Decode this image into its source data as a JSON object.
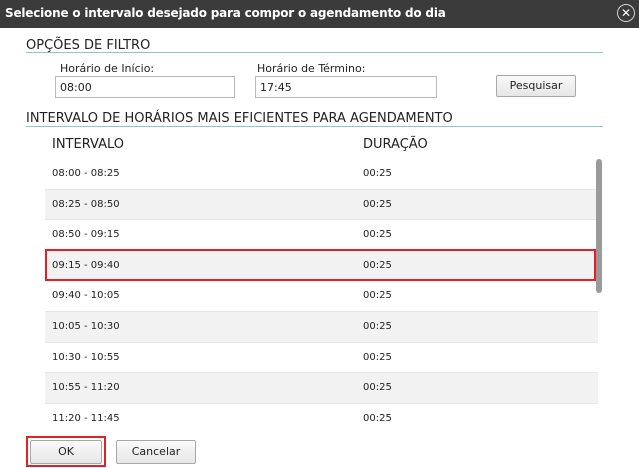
{
  "dialog": {
    "title": "Selecione o intervalo desejado para compor o agendamento do dia",
    "close_glyph": "✕"
  },
  "filter": {
    "section_title": "OPÇÕES DE FILTRO",
    "start_label": "Horário de Início:",
    "start_value": "08:00",
    "end_label": "Horário de Término:",
    "end_value": "17:45",
    "search_button": "Pesquisar"
  },
  "intervals": {
    "section_title": "INTERVALO DE HORÁRIOS MAIS EFICIENTES PARA AGENDAMENTO",
    "col_interval": "INTERVALO",
    "col_duration": "DURAÇÃO",
    "rows": [
      {
        "interval": "08:00 - 08:25",
        "duration": "00:25"
      },
      {
        "interval": "08:25 - 08:50",
        "duration": "00:25"
      },
      {
        "interval": "08:50 - 09:15",
        "duration": "00:25"
      },
      {
        "interval": "09:15 - 09:40",
        "duration": "00:25"
      },
      {
        "interval": "09:40 - 10:05",
        "duration": "00:25"
      },
      {
        "interval": "10:05 - 10:30",
        "duration": "00:25"
      },
      {
        "interval": "10:30 - 10:55",
        "duration": "00:25"
      },
      {
        "interval": "10:55 - 11:20",
        "duration": "00:25"
      },
      {
        "interval": "11:20 - 11:45",
        "duration": "00:25"
      }
    ],
    "selected_index": 3
  },
  "footer": {
    "ok_button": "OK",
    "cancel_button": "Cancelar"
  },
  "colors": {
    "titlebar": "#3b3b3b",
    "accent_line": "#8fc7c2",
    "highlight": "#e0202a"
  }
}
